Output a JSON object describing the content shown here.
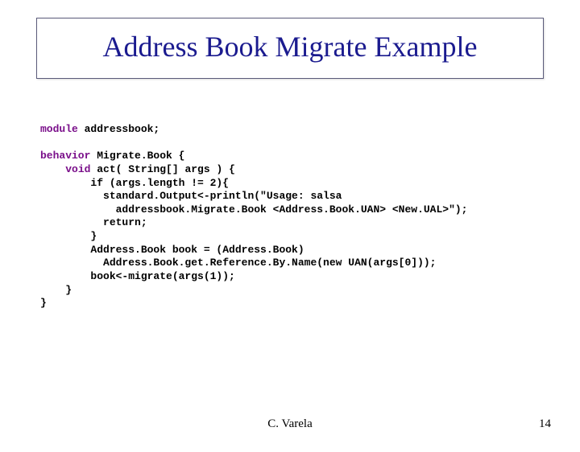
{
  "slide": {
    "title": "Address Book Migrate Example",
    "author": "C. Varela",
    "page_number": "14"
  },
  "code": {
    "kw_module": "module",
    "l1_rest": " addressbook;",
    "kw_behavior": "behavior",
    "l2_rest": " Migrate.Book {",
    "kw_void": "void",
    "l3_rest": " act( String[] args ) {",
    "l4": "        if (args.length != 2){",
    "l5": "          standard.Output<-println(\"Usage: salsa",
    "l6": "            addressbook.Migrate.Book <Address.Book.UAN> <New.UAL>\");",
    "l7": "          return;",
    "l8": "        }",
    "l9": "        Address.Book book = (Address.Book)",
    "l10": "          Address.Book.get.Reference.By.Name(new UAN(args[0]));",
    "l11": "        book<-migrate(args(1));",
    "l12": "    }",
    "l13": "}"
  }
}
